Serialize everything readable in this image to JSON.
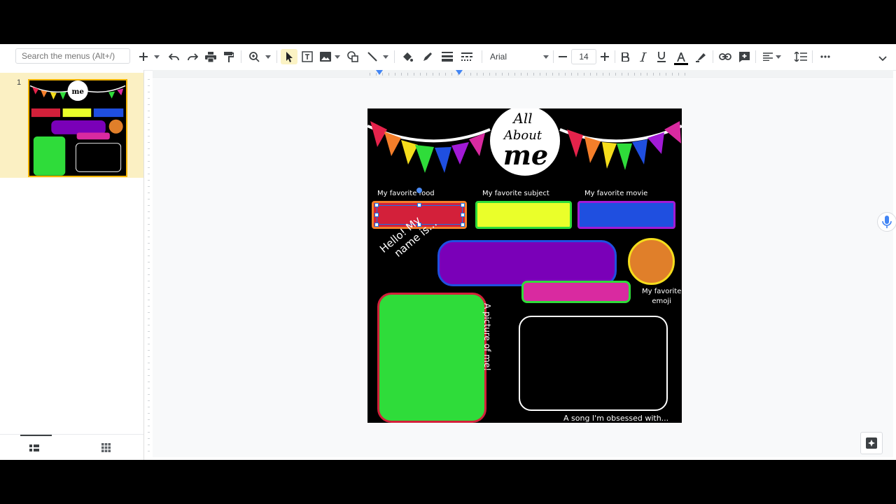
{
  "toolbar": {
    "search_placeholder": "Search the menus (Alt+/)",
    "font_name": "Arial",
    "font_size": "14"
  },
  "filmstrip": {
    "slides": [
      {
        "number": "1"
      }
    ]
  },
  "slide": {
    "title_line1": "All",
    "title_line2": "About",
    "title_line3": "me",
    "labels": {
      "food": "My favorite food",
      "subject": "My favorite subject",
      "movie": "My favorite movie",
      "hello_line1": "Hello! My",
      "hello_line2": "name is...",
      "emoji_line1": "My favorite",
      "emoji_line2": "emoji",
      "picture": "A picture of me!",
      "song": "A song I'm obsessed with..."
    }
  },
  "colors": {
    "accent": "#1a73e8",
    "selected_slide_bg": "#fbf0c3",
    "food_box": "#d3203a",
    "subject_box": "#eaff2a",
    "movie_box": "#1f4fe0",
    "name_box": "#7a00b8",
    "name_sub_box": "#d92aa0",
    "emoji_circle": "#e07f2a",
    "picture_box": "#2fdc3a"
  },
  "icons": [
    "plus-icon",
    "undo-icon",
    "redo-icon",
    "print-icon",
    "paint-format-icon",
    "zoom-icon",
    "select-icon",
    "textbox-icon",
    "image-icon",
    "shape-icon",
    "line-icon",
    "fill-color-icon",
    "border-color-icon",
    "border-weight-icon",
    "border-dash-icon",
    "bold-icon",
    "italic-icon",
    "underline-icon",
    "text-color-icon",
    "highlight-icon",
    "link-icon",
    "comment-icon",
    "align-icon",
    "line-spacing-icon",
    "more-icon",
    "chevron-up-icon",
    "microphone-icon",
    "explore-icon",
    "filmstrip-view-icon",
    "grid-view-icon"
  ]
}
